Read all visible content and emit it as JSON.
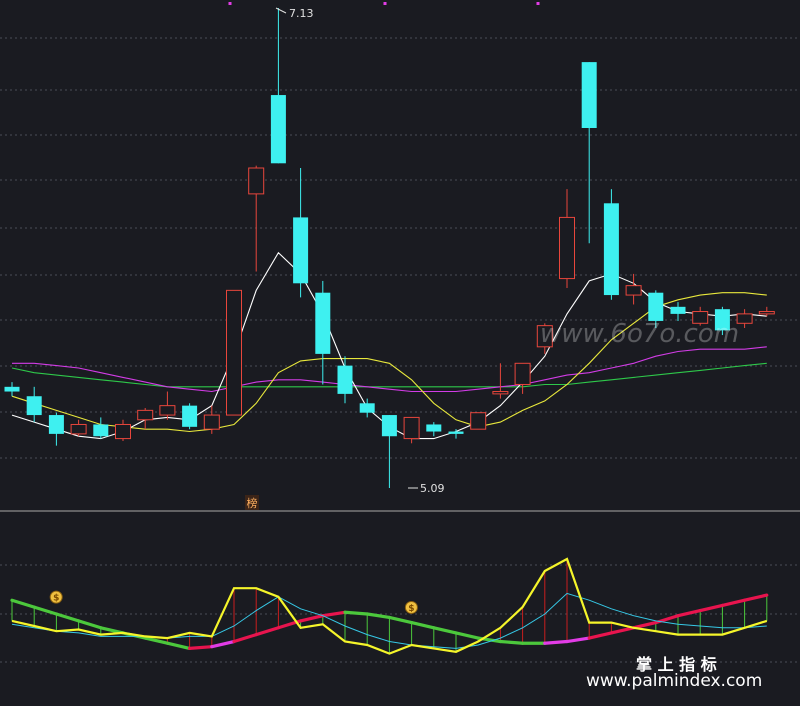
{
  "chart_data": [
    {
      "type": "candlestick",
      "panel": "main",
      "annotations": {
        "high_label": "7.13",
        "low_label": "5.09",
        "marker_glyph": "榜"
      },
      "colors": {
        "up": "#e8463c",
        "down": "#3ef0f0",
        "ma5": "#ffffff",
        "ma10": "#e8e83c",
        "ma20": "#d23ce6",
        "ma60": "#2ec84a"
      },
      "candles": [
        {
          "open": 5.52,
          "close": 5.5,
          "high": 5.54,
          "low": 5.48
        },
        {
          "open": 5.48,
          "close": 5.4,
          "high": 5.52,
          "low": 5.37
        },
        {
          "open": 5.4,
          "close": 5.32,
          "high": 5.41,
          "low": 5.27
        },
        {
          "open": 5.32,
          "close": 5.36,
          "high": 5.38,
          "low": 5.31
        },
        {
          "open": 5.36,
          "close": 5.31,
          "high": 5.39,
          "low": 5.3
        },
        {
          "open": 5.3,
          "close": 5.36,
          "high": 5.38,
          "low": 5.29
        },
        {
          "open": 5.38,
          "close": 5.42,
          "high": 5.43,
          "low": 5.34
        },
        {
          "open": 5.4,
          "close": 5.44,
          "high": 5.5,
          "low": 5.38
        },
        {
          "open": 5.44,
          "close": 5.35,
          "high": 5.45,
          "low": 5.34
        },
        {
          "open": 5.34,
          "close": 5.4,
          "high": 5.44,
          "low": 5.32
        },
        {
          "open": 5.4,
          "close": 5.93,
          "high": 5.93,
          "low": 5.4
        },
        {
          "open": 6.34,
          "close": 6.45,
          "high": 6.46,
          "low": 6.01
        },
        {
          "open": 6.76,
          "close": 6.47,
          "high": 7.13,
          "low": 6.47
        },
        {
          "open": 6.24,
          "close": 5.96,
          "high": 6.45,
          "low": 5.9
        },
        {
          "open": 5.92,
          "close": 5.66,
          "high": 5.97,
          "low": 5.53
        },
        {
          "open": 5.61,
          "close": 5.49,
          "high": 5.65,
          "low": 5.45
        },
        {
          "open": 5.45,
          "close": 5.41,
          "high": 5.47,
          "low": 5.39
        },
        {
          "open": 5.4,
          "close": 5.31,
          "high": 5.4,
          "low": 5.09
        },
        {
          "open": 5.3,
          "close": 5.39,
          "high": 5.39,
          "low": 5.28
        },
        {
          "open": 5.36,
          "close": 5.33,
          "high": 5.37,
          "low": 5.31
        },
        {
          "open": 5.33,
          "close": 5.32,
          "high": 5.34,
          "low": 5.3
        },
        {
          "open": 5.34,
          "close": 5.41,
          "high": 5.41,
          "low": 5.34
        },
        {
          "open": 5.49,
          "close": 5.5,
          "high": 5.62,
          "low": 5.47
        },
        {
          "open": 5.53,
          "close": 5.62,
          "high": 5.62,
          "low": 5.49
        },
        {
          "open": 5.69,
          "close": 5.78,
          "high": 5.79,
          "low": 5.66
        },
        {
          "open": 5.98,
          "close": 6.24,
          "high": 6.36,
          "low": 5.94
        },
        {
          "open": 6.9,
          "close": 6.62,
          "high": 6.9,
          "low": 6.13
        },
        {
          "open": 6.3,
          "close": 5.91,
          "high": 6.36,
          "low": 5.89
        },
        {
          "open": 5.91,
          "close": 5.95,
          "high": 6.0,
          "low": 5.87
        },
        {
          "open": 5.92,
          "close": 5.8,
          "high": 5.93,
          "low": 5.77
        },
        {
          "open": 5.86,
          "close": 5.83,
          "high": 5.88,
          "low": 5.8
        },
        {
          "open": 5.79,
          "close": 5.84,
          "high": 5.86,
          "low": 5.78
        },
        {
          "open": 5.85,
          "close": 5.76,
          "high": 5.86,
          "low": 5.74
        },
        {
          "open": 5.79,
          "close": 5.83,
          "high": 5.85,
          "low": 5.77
        },
        {
          "open": 5.83,
          "close": 5.84,
          "high": 5.86,
          "low": 5.82
        }
      ],
      "ma5": [
        5.4,
        5.37,
        5.34,
        5.31,
        5.3,
        5.33,
        5.38,
        5.39,
        5.38,
        5.44,
        5.66,
        5.93,
        6.09,
        6.0,
        5.83,
        5.6,
        5.43,
        5.35,
        5.3,
        5.3,
        5.33,
        5.37,
        5.44,
        5.54,
        5.65,
        5.83,
        5.97,
        6.0,
        5.96,
        5.88,
        5.84,
        5.83,
        5.82,
        5.83,
        5.82
      ],
      "ma10": [
        5.48,
        5.45,
        5.42,
        5.39,
        5.36,
        5.35,
        5.34,
        5.34,
        5.33,
        5.34,
        5.36,
        5.45,
        5.58,
        5.63,
        5.64,
        5.64,
        5.64,
        5.62,
        5.55,
        5.45,
        5.38,
        5.35,
        5.37,
        5.42,
        5.46,
        5.53,
        5.62,
        5.72,
        5.79,
        5.86,
        5.89,
        5.91,
        5.92,
        5.92,
        5.91
      ],
      "ma20": [
        5.62,
        5.62,
        5.61,
        5.6,
        5.58,
        5.56,
        5.54,
        5.52,
        5.51,
        5.5,
        5.52,
        5.54,
        5.55,
        5.55,
        5.54,
        5.53,
        5.52,
        5.51,
        5.5,
        5.5,
        5.5,
        5.51,
        5.52,
        5.53,
        5.55,
        5.57,
        5.58,
        5.6,
        5.62,
        5.65,
        5.67,
        5.68,
        5.68,
        5.68,
        5.69
      ],
      "ma60": [
        5.6,
        5.58,
        5.57,
        5.56,
        5.55,
        5.54,
        5.53,
        5.52,
        5.52,
        5.52,
        5.52,
        5.52,
        5.52,
        5.52,
        5.52,
        5.52,
        5.52,
        5.52,
        5.52,
        5.52,
        5.52,
        5.52,
        5.52,
        5.52,
        5.53,
        5.53,
        5.54,
        5.55,
        5.56,
        5.57,
        5.58,
        5.59,
        5.6,
        5.61,
        5.62
      ]
    },
    {
      "type": "line",
      "panel": "indicator",
      "colors": {
        "fast": "#f5f52a",
        "signal": "#36c8e6",
        "slow_up": "#e8144e",
        "slow_down": "#4cc83c",
        "slow_turn": "#e23ce6",
        "bar_up": "#c81e1e",
        "bar_down": "#4cc83c"
      },
      "fast": [
        54,
        57,
        60,
        59,
        62,
        61,
        63,
        64,
        61,
        63,
        35,
        35,
        40,
        58,
        56,
        66,
        68,
        73,
        68,
        70,
        72,
        66,
        58,
        46,
        25,
        18,
        55,
        55,
        58,
        60,
        62,
        62,
        62,
        58,
        54
      ],
      "signal": [
        56,
        58,
        60,
        61,
        63,
        63,
        63,
        64,
        63,
        63,
        57,
        48,
        40,
        47,
        51,
        57,
        62,
        66,
        68,
        69,
        70,
        68,
        64,
        58,
        50,
        38,
        42,
        47,
        51,
        54,
        56,
        57,
        58,
        58,
        57
      ],
      "slow": [
        42,
        46,
        50,
        54,
        58,
        61,
        64,
        67,
        70,
        69,
        66,
        62,
        58,
        54,
        51,
        49,
        50,
        52,
        55,
        58,
        61,
        64,
        66,
        67,
        67,
        66,
        64,
        61,
        58,
        55,
        51,
        48,
        45,
        42,
        39
      ],
      "flags": [
        "$",
        "$"
      ]
    }
  ],
  "watermarks": {
    "top": "www.6o7o.com",
    "bottom_line1": "掌 上 指 标",
    "bottom_line2": "www.palmindex.com"
  }
}
